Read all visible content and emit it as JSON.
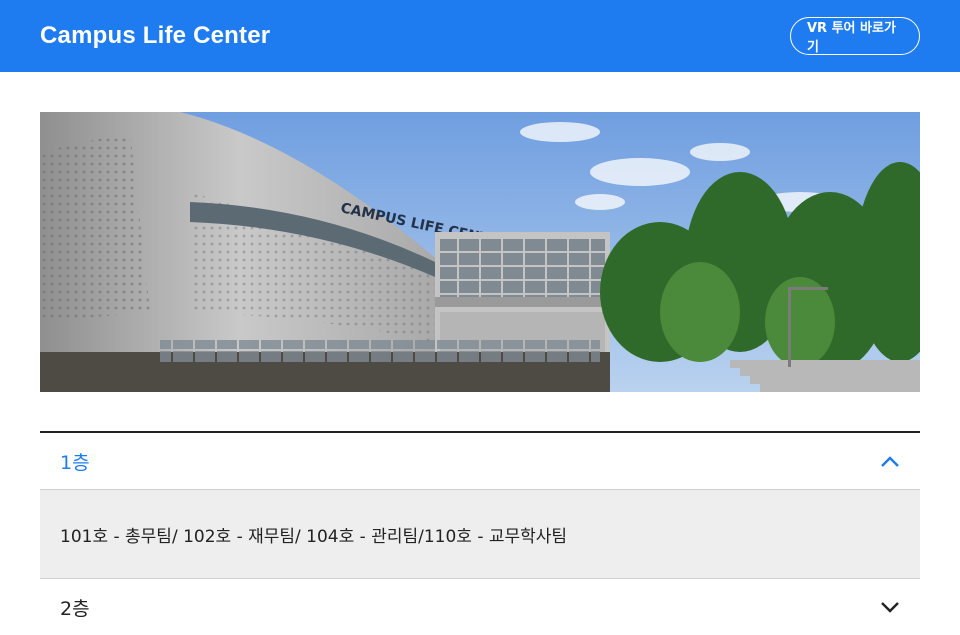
{
  "header": {
    "title": "Campus Life Center",
    "vr_button_label": "VR 투어 바로가기",
    "background_color": "#1f7bf0"
  },
  "hero": {
    "image_description": "building-photo",
    "building_sign": "CAMPUS LIFE CENTER"
  },
  "accordion": {
    "accent_color": "#1f7bf0",
    "items": [
      {
        "title": "1층",
        "expanded": true,
        "icon": "chevron-up-icon",
        "content": "101호 - 총무팀/ 102호 - 재무팀/ 104호 - 관리팀/110호 - 교무학사팀"
      },
      {
        "title": "2층",
        "expanded": false,
        "icon": "chevron-down-icon"
      }
    ]
  }
}
